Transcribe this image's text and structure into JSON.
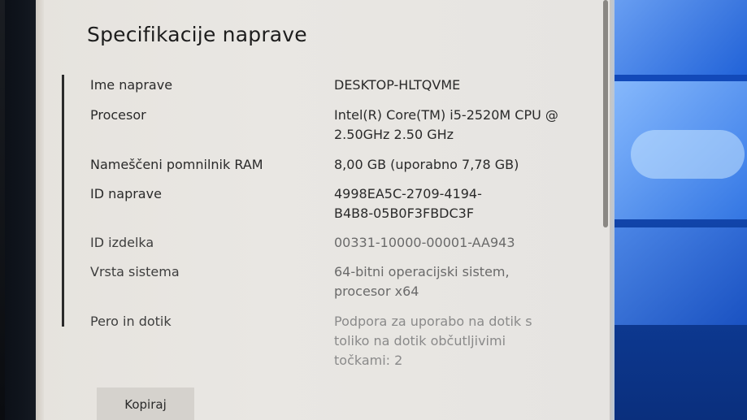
{
  "window": {
    "title": "Specifikacije naprave"
  },
  "specs": [
    {
      "label": "Ime naprave",
      "value": "DESKTOP-HLTQVME"
    },
    {
      "label": "Procesor",
      "value": "Intel(R) Core(TM) i5-2520M CPU @\n2.50GHz   2.50 GHz"
    },
    {
      "label": "Nameščeni pomnilnik RAM",
      "value": "8,00 GB (uporabno 7,78 GB)"
    },
    {
      "label": "ID naprave",
      "value": "4998EA5C-2709-4194-\nB4B8-05B0F3FBDC3F"
    },
    {
      "label": "ID izdelka",
      "value": "00331-10000-00001-AA943"
    },
    {
      "label": "Vrsta sistema",
      "value": "64-bitni operacijski sistem,\nprocesor x64"
    },
    {
      "label": "Pero in dotik",
      "value": "Podpora za uporabo na dotik s\ntoliko na dotik občutljivimi\ntočkami: 2"
    }
  ],
  "buttons": {
    "copy_label": "Kopiraj"
  },
  "colors": {
    "window_bg": "#e8e6e2",
    "text": "#2a2a2a",
    "desktop_accent": "#1552c8"
  }
}
